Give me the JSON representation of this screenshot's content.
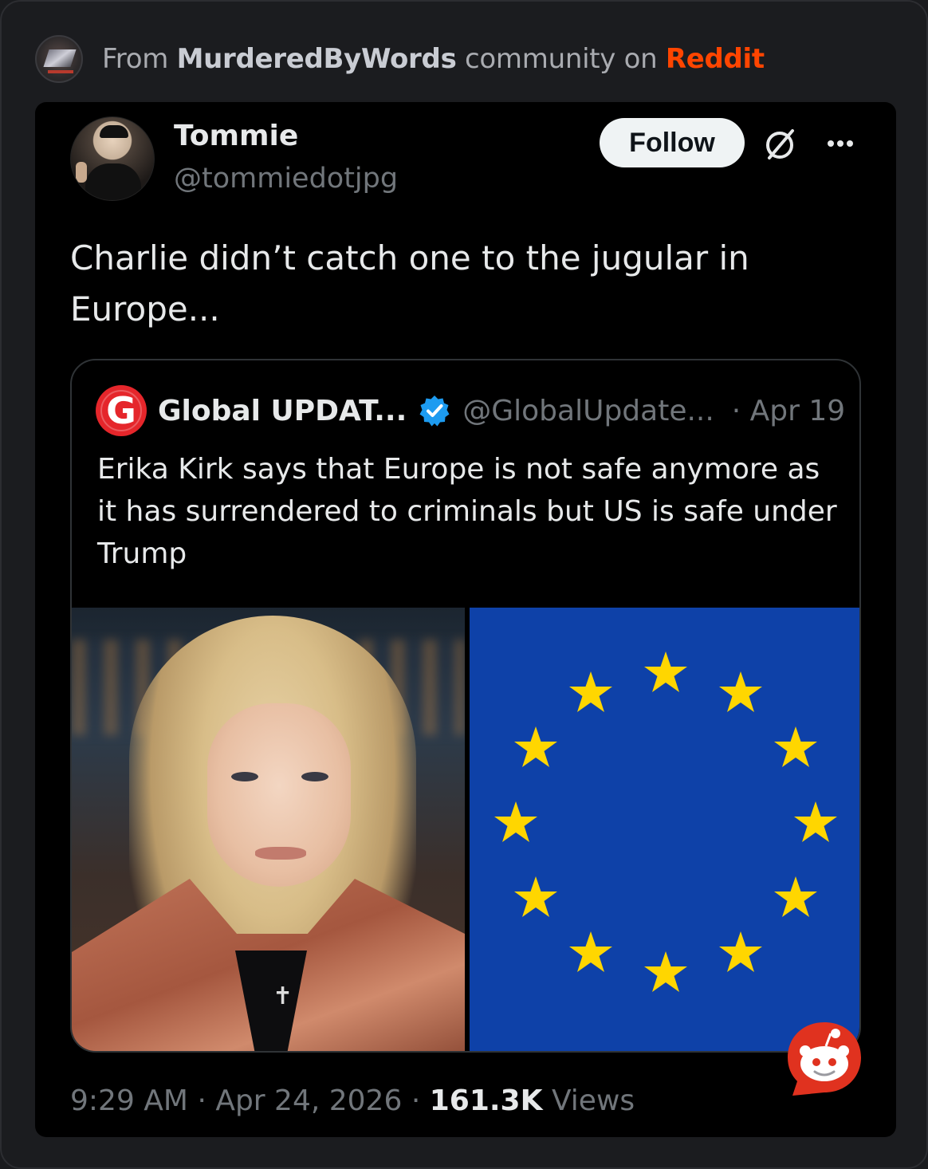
{
  "reddit_header": {
    "from": "From",
    "community": "MurderedByWords",
    "community_on": "community on",
    "platform": "Reddit"
  },
  "tweet": {
    "user_name": "Tommie",
    "user_handle": "@tommiedotjpg",
    "follow_label": "Follow",
    "text": "Charlie didn’t catch one to the jugular in Europe...",
    "time": "9:29 AM",
    "date": "Apr 24, 2026",
    "views_count": "161.3K",
    "views_label": "Views"
  },
  "quoted_tweet": {
    "author_name": "Global UPDAT...",
    "author_handle": "@GlobalUpdate...",
    "date": "· Apr 19",
    "text": "Erika Kirk says that Europe is not safe anymore as it has surrendered to criminals but US is safe under Trump",
    "logo_letter": "G"
  },
  "icons": {
    "grok": "grok-icon",
    "more": "more-icon",
    "verified": "verified-badge-icon",
    "reddit": "reddit-snoo-icon"
  },
  "colors": {
    "reddit_orange": "#ff4500",
    "verified_blue": "#1d9bf0",
    "eu_blue": "#0e41a8",
    "eu_star": "#ffd600"
  }
}
